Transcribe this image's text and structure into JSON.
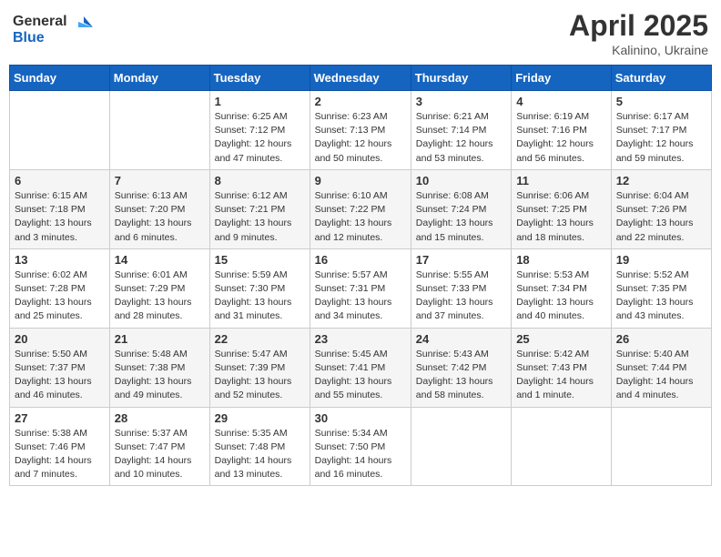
{
  "logo": {
    "general": "General",
    "blue": "Blue"
  },
  "title": {
    "month": "April 2025",
    "location": "Kalinino, Ukraine"
  },
  "weekdays": [
    "Sunday",
    "Monday",
    "Tuesday",
    "Wednesday",
    "Thursday",
    "Friday",
    "Saturday"
  ],
  "weeks": [
    [
      {
        "day": "",
        "content": ""
      },
      {
        "day": "",
        "content": ""
      },
      {
        "day": "1",
        "content": "Sunrise: 6:25 AM\nSunset: 7:12 PM\nDaylight: 12 hours and 47 minutes."
      },
      {
        "day": "2",
        "content": "Sunrise: 6:23 AM\nSunset: 7:13 PM\nDaylight: 12 hours and 50 minutes."
      },
      {
        "day": "3",
        "content": "Sunrise: 6:21 AM\nSunset: 7:14 PM\nDaylight: 12 hours and 53 minutes."
      },
      {
        "day": "4",
        "content": "Sunrise: 6:19 AM\nSunset: 7:16 PM\nDaylight: 12 hours and 56 minutes."
      },
      {
        "day": "5",
        "content": "Sunrise: 6:17 AM\nSunset: 7:17 PM\nDaylight: 12 hours and 59 minutes."
      }
    ],
    [
      {
        "day": "6",
        "content": "Sunrise: 6:15 AM\nSunset: 7:18 PM\nDaylight: 13 hours and 3 minutes."
      },
      {
        "day": "7",
        "content": "Sunrise: 6:13 AM\nSunset: 7:20 PM\nDaylight: 13 hours and 6 minutes."
      },
      {
        "day": "8",
        "content": "Sunrise: 6:12 AM\nSunset: 7:21 PM\nDaylight: 13 hours and 9 minutes."
      },
      {
        "day": "9",
        "content": "Sunrise: 6:10 AM\nSunset: 7:22 PM\nDaylight: 13 hours and 12 minutes."
      },
      {
        "day": "10",
        "content": "Sunrise: 6:08 AM\nSunset: 7:24 PM\nDaylight: 13 hours and 15 minutes."
      },
      {
        "day": "11",
        "content": "Sunrise: 6:06 AM\nSunset: 7:25 PM\nDaylight: 13 hours and 18 minutes."
      },
      {
        "day": "12",
        "content": "Sunrise: 6:04 AM\nSunset: 7:26 PM\nDaylight: 13 hours and 22 minutes."
      }
    ],
    [
      {
        "day": "13",
        "content": "Sunrise: 6:02 AM\nSunset: 7:28 PM\nDaylight: 13 hours and 25 minutes."
      },
      {
        "day": "14",
        "content": "Sunrise: 6:01 AM\nSunset: 7:29 PM\nDaylight: 13 hours and 28 minutes."
      },
      {
        "day": "15",
        "content": "Sunrise: 5:59 AM\nSunset: 7:30 PM\nDaylight: 13 hours and 31 minutes."
      },
      {
        "day": "16",
        "content": "Sunrise: 5:57 AM\nSunset: 7:31 PM\nDaylight: 13 hours and 34 minutes."
      },
      {
        "day": "17",
        "content": "Sunrise: 5:55 AM\nSunset: 7:33 PM\nDaylight: 13 hours and 37 minutes."
      },
      {
        "day": "18",
        "content": "Sunrise: 5:53 AM\nSunset: 7:34 PM\nDaylight: 13 hours and 40 minutes."
      },
      {
        "day": "19",
        "content": "Sunrise: 5:52 AM\nSunset: 7:35 PM\nDaylight: 13 hours and 43 minutes."
      }
    ],
    [
      {
        "day": "20",
        "content": "Sunrise: 5:50 AM\nSunset: 7:37 PM\nDaylight: 13 hours and 46 minutes."
      },
      {
        "day": "21",
        "content": "Sunrise: 5:48 AM\nSunset: 7:38 PM\nDaylight: 13 hours and 49 minutes."
      },
      {
        "day": "22",
        "content": "Sunrise: 5:47 AM\nSunset: 7:39 PM\nDaylight: 13 hours and 52 minutes."
      },
      {
        "day": "23",
        "content": "Sunrise: 5:45 AM\nSunset: 7:41 PM\nDaylight: 13 hours and 55 minutes."
      },
      {
        "day": "24",
        "content": "Sunrise: 5:43 AM\nSunset: 7:42 PM\nDaylight: 13 hours and 58 minutes."
      },
      {
        "day": "25",
        "content": "Sunrise: 5:42 AM\nSunset: 7:43 PM\nDaylight: 14 hours and 1 minute."
      },
      {
        "day": "26",
        "content": "Sunrise: 5:40 AM\nSunset: 7:44 PM\nDaylight: 14 hours and 4 minutes."
      }
    ],
    [
      {
        "day": "27",
        "content": "Sunrise: 5:38 AM\nSunset: 7:46 PM\nDaylight: 14 hours and 7 minutes."
      },
      {
        "day": "28",
        "content": "Sunrise: 5:37 AM\nSunset: 7:47 PM\nDaylight: 14 hours and 10 minutes."
      },
      {
        "day": "29",
        "content": "Sunrise: 5:35 AM\nSunset: 7:48 PM\nDaylight: 14 hours and 13 minutes."
      },
      {
        "day": "30",
        "content": "Sunrise: 5:34 AM\nSunset: 7:50 PM\nDaylight: 14 hours and 16 minutes."
      },
      {
        "day": "",
        "content": ""
      },
      {
        "day": "",
        "content": ""
      },
      {
        "day": "",
        "content": ""
      }
    ]
  ]
}
